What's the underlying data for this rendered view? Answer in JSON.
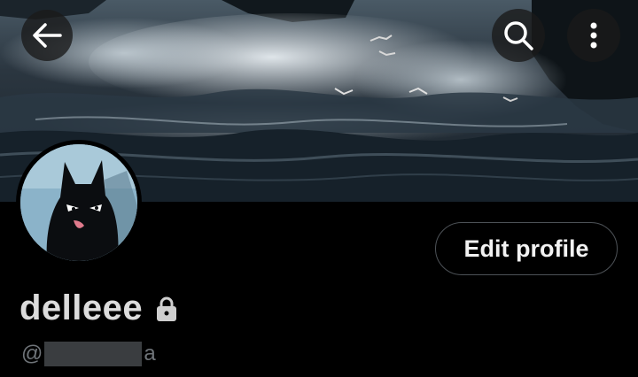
{
  "header": {
    "back_icon": "arrow-left-icon",
    "search_icon": "search-icon",
    "more_icon": "more-vertical-icon"
  },
  "banner": {
    "description_icon": "banner-image"
  },
  "profile": {
    "avatar_icon": "avatar",
    "edit_button_label": "Edit profile",
    "display_name": "delleee",
    "lock_icon": "lock-icon",
    "handle_prefix": "@",
    "handle_suffix": "a"
  },
  "colors": {
    "background": "#000000",
    "name_text": "#dcdcdc",
    "handle_text": "#6f7479",
    "button_border": "#4d5257"
  }
}
